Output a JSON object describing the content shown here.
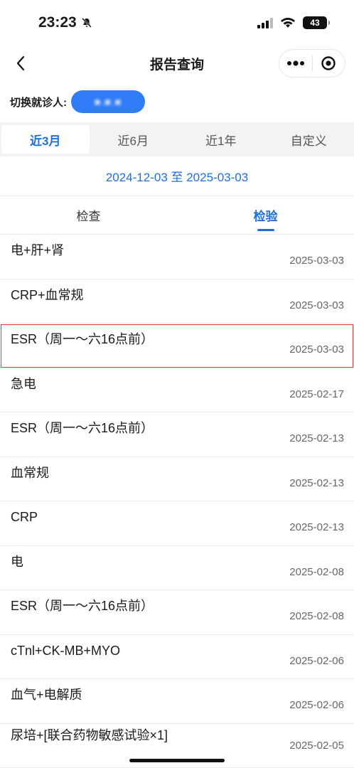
{
  "status_bar": {
    "time": "23:23",
    "battery": "43"
  },
  "nav": {
    "title": "报告查询"
  },
  "patient": {
    "label": "切换就诊人:",
    "name": "■.■.■"
  },
  "periods": [
    {
      "label": "近3月",
      "active": true
    },
    {
      "label": "近6月",
      "active": false
    },
    {
      "label": "近1年",
      "active": false
    },
    {
      "label": "自定义",
      "active": false
    }
  ],
  "date_range": "2024-12-03 至 2025-03-03",
  "tabs": [
    {
      "label": "检查",
      "active": false
    },
    {
      "label": "检验",
      "active": true
    }
  ],
  "reports": [
    {
      "name": "电+肝+肾",
      "date": "2025-03-03"
    },
    {
      "name": "CRP+血常规",
      "date": "2025-03-03"
    },
    {
      "name": "ESR（周一～六16点前）",
      "date": "2025-03-03",
      "highlighted": true
    },
    {
      "name": "急电",
      "date": "2025-02-17"
    },
    {
      "name": "ESR（周一～六16点前）",
      "date": "2025-02-13"
    },
    {
      "name": "血常规",
      "date": "2025-02-13"
    },
    {
      "name": "CRP",
      "date": "2025-02-13"
    },
    {
      "name": "电",
      "date": "2025-02-08"
    },
    {
      "name": "ESR（周一～六16点前）",
      "date": "2025-02-08"
    },
    {
      "name": "cTnl+CK-MB+MYO",
      "date": "2025-02-06"
    },
    {
      "name": "血气+电解质",
      "date": "2025-02-06"
    },
    {
      "name": "尿培+[联合药物敏感试验×1]",
      "date": "2025-02-05"
    }
  ],
  "colors": {
    "accent": "#1e6fd9",
    "pill": "#2f7cf6",
    "highlight_border": "#e53935"
  }
}
